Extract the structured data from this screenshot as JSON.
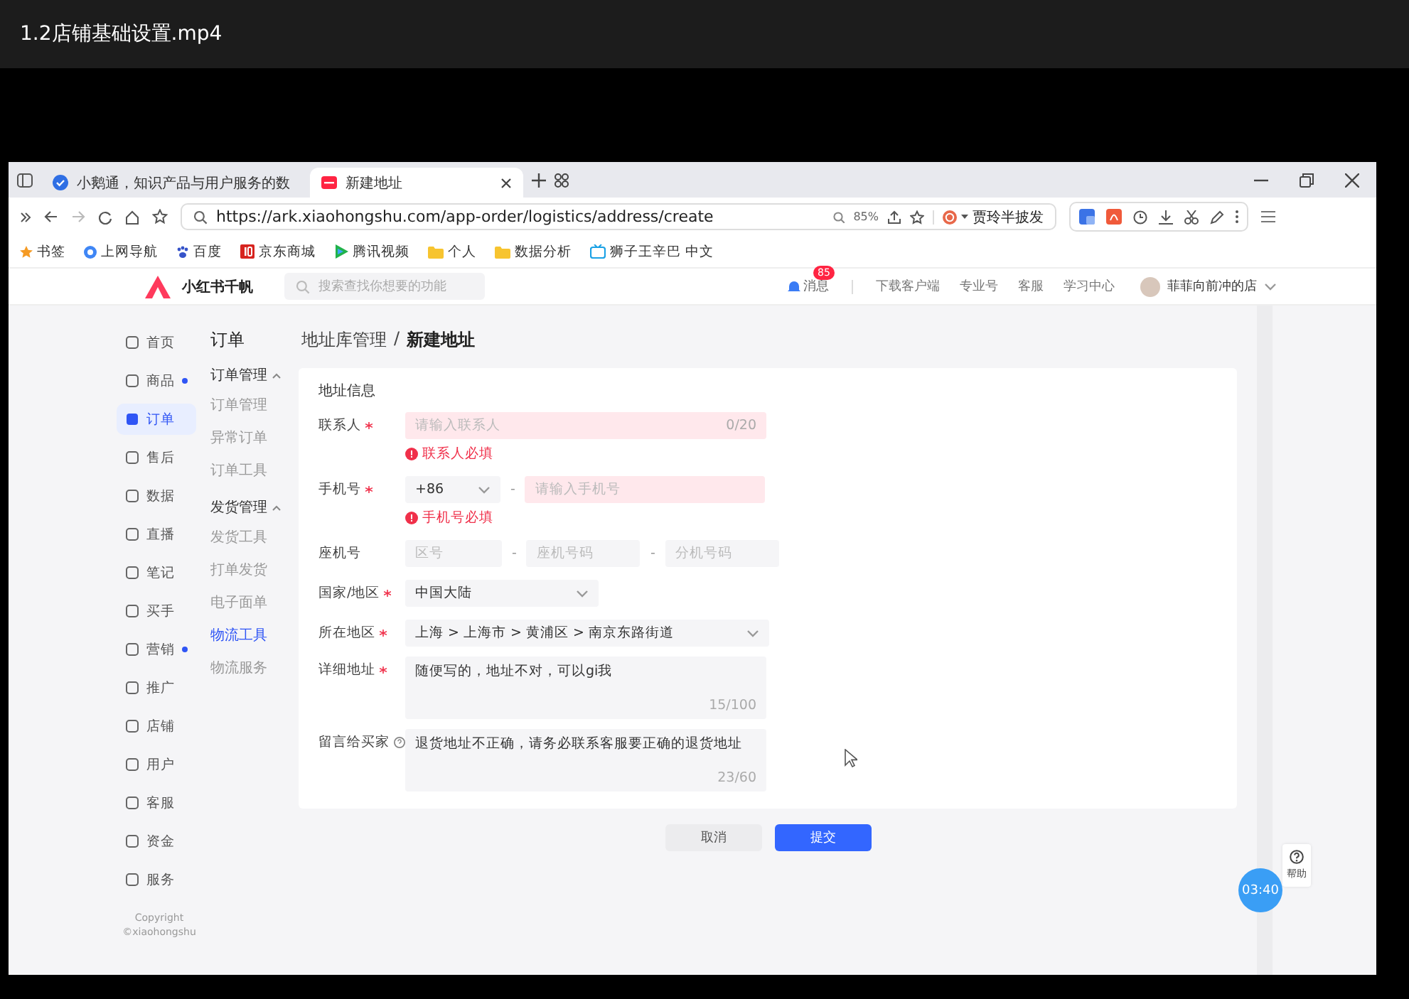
{
  "player": {
    "title": "1.2店铺基础设置.mp4"
  },
  "browser": {
    "tabs": [
      {
        "label": "小鹅通，知识产品与用户服务的数",
        "selected": false
      },
      {
        "label": "新建地址",
        "selected": true
      }
    ],
    "url": "https://ark.xiaohongshu.com/app-order/logistics/address/create",
    "zoom": "85%",
    "hot_search": "贾玲半披发",
    "bookmarks": [
      {
        "label": "书签",
        "kind": "star"
      },
      {
        "label": "上网导航",
        "kind": "globe"
      },
      {
        "label": "百度",
        "kind": "paw"
      },
      {
        "label": "京东商城",
        "kind": "jd"
      },
      {
        "label": "腾讯视频",
        "kind": "play"
      },
      {
        "label": "个人",
        "kind": "folder"
      },
      {
        "label": "数据分析",
        "kind": "folder"
      },
      {
        "label": "狮子王辛巴 中文",
        "kind": "tv"
      }
    ]
  },
  "app": {
    "brand": "小红书千帆",
    "search": {
      "placeholder": "搜索查找你想要的功能"
    },
    "message": {
      "label": "消息",
      "badge": "85"
    },
    "links": [
      "下载客户端",
      "专业号",
      "客服",
      "学习中心"
    ],
    "user": "菲菲向前冲的店"
  },
  "nav": {
    "items": [
      {
        "label": "首页",
        "selected": false,
        "dot": false
      },
      {
        "label": "商品",
        "selected": false,
        "dot": true
      },
      {
        "label": "订单",
        "selected": true,
        "dot": false
      },
      {
        "label": "售后",
        "selected": false,
        "dot": false
      },
      {
        "label": "数据",
        "selected": false,
        "dot": false
      },
      {
        "label": "直播",
        "selected": false,
        "dot": false
      },
      {
        "label": "笔记",
        "selected": false,
        "dot": false
      },
      {
        "label": "买手",
        "selected": false,
        "dot": false
      },
      {
        "label": "营销",
        "selected": false,
        "dot": true
      },
      {
        "label": "推广",
        "selected": false,
        "dot": false
      },
      {
        "label": "店铺",
        "selected": false,
        "dot": false
      },
      {
        "label": "用户",
        "selected": false,
        "dot": false
      },
      {
        "label": "客服",
        "selected": false,
        "dot": false
      },
      {
        "label": "资金",
        "selected": false,
        "dot": false
      },
      {
        "label": "服务",
        "selected": false,
        "dot": false
      }
    ],
    "copyright": [
      "Copyright",
      "©xiaohongshu"
    ]
  },
  "subnav": {
    "title": "订单",
    "groups": [
      {
        "label": "订单管理",
        "expanded": true,
        "children": [
          {
            "label": "订单管理",
            "selected": false
          },
          {
            "label": "异常订单",
            "selected": false
          },
          {
            "label": "订单工具",
            "selected": false
          }
        ]
      },
      {
        "label": "发货管理",
        "expanded": true,
        "children": [
          {
            "label": "发货工具",
            "selected": false
          },
          {
            "label": "打单发货",
            "selected": false
          },
          {
            "label": "电子面单",
            "selected": false
          },
          {
            "label": "物流工具",
            "selected": true
          },
          {
            "label": "物流服务",
            "selected": false
          }
        ]
      }
    ]
  },
  "breadcrumb": {
    "parent": "地址库管理",
    "separator": "/",
    "current": "新建地址"
  },
  "form": {
    "section": "地址信息",
    "fields": [
      {
        "kind": "text",
        "label": "联系人",
        "required": true,
        "help": false,
        "placeholder": "请输入联系人",
        "counter": "0/20",
        "error": "联系人必填"
      },
      {
        "kind": "phone",
        "label": "手机号",
        "required": true,
        "help": false,
        "code": "+86",
        "separator": "-",
        "placeholder": "请输入手机号",
        "error": "手机号必填"
      },
      {
        "kind": "landline",
        "label": "座机号",
        "required": false,
        "help": false,
        "separators": [
          "-",
          "-"
        ],
        "placeholders": [
          "区号",
          "座机号码",
          "分机号码"
        ]
      },
      {
        "kind": "select",
        "label": "国家/地区",
        "required": true,
        "help": false,
        "value": "中国大陆"
      },
      {
        "kind": "select_wide",
        "label": "所在地区",
        "required": true,
        "help": false,
        "value": "上海 > 上海市 > 黄浦区 > 南京东路街道"
      },
      {
        "kind": "textarea",
        "label": "详细地址",
        "required": true,
        "help": false,
        "value": "随便写的，地址不对，可以gi我",
        "counter": "15/100"
      },
      {
        "kind": "textarea",
        "label": "留言给买家",
        "required": false,
        "help": true,
        "value": "退货地址不正确，请务必联系客服要正确的退货地址",
        "counter": "23/60"
      }
    ]
  },
  "buttons": [
    {
      "label": "取消",
      "kind": "secondary"
    },
    {
      "label": "提交",
      "kind": "primary"
    }
  ],
  "floating": {
    "help": "帮助",
    "timer": "03:40"
  }
}
